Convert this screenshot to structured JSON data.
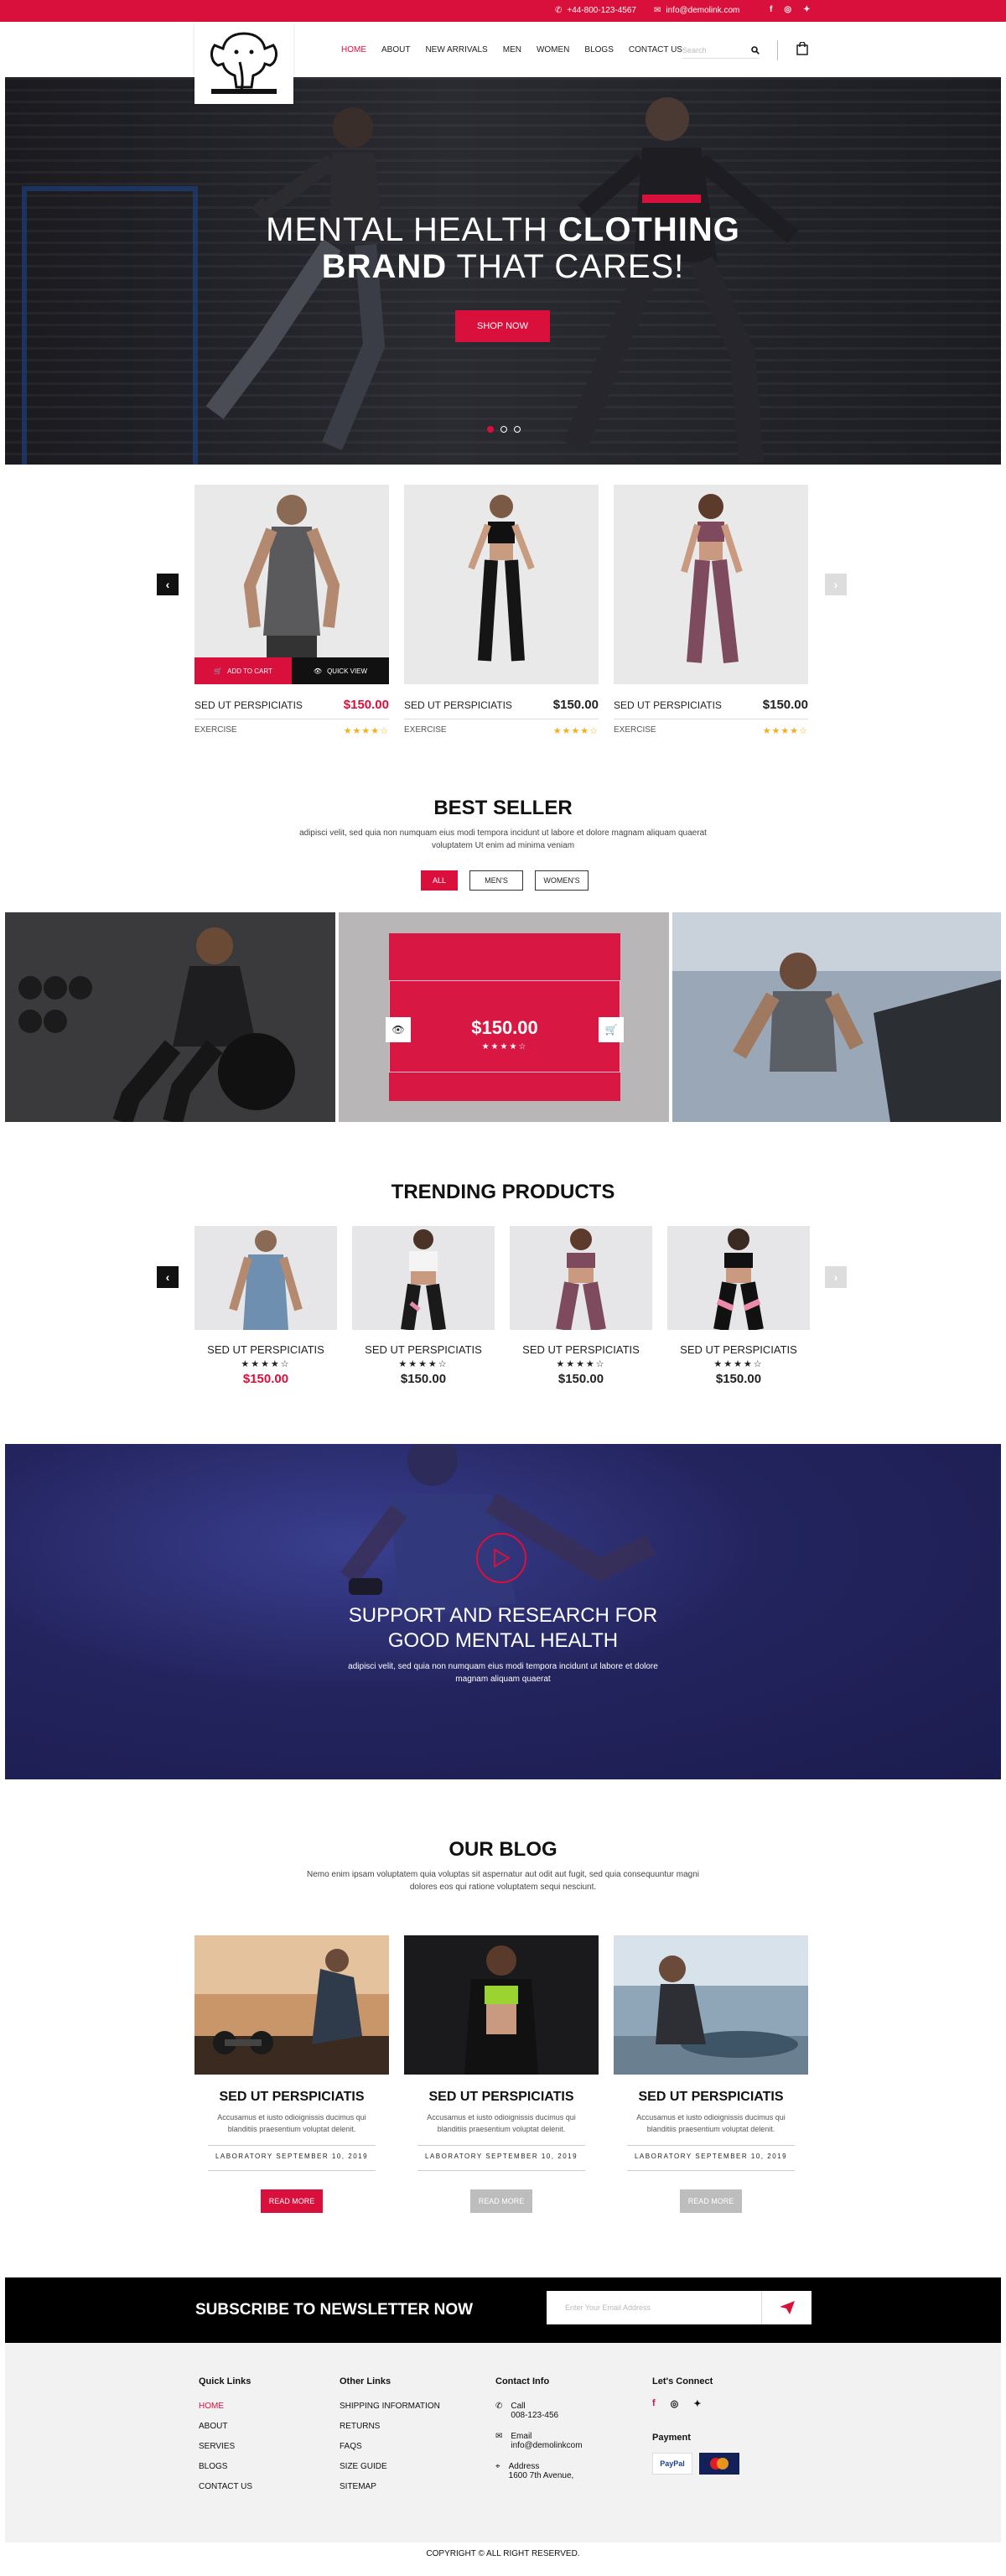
{
  "colors": {
    "accent": "#d90f3c",
    "dark": "#111111",
    "banner": "#1f2057"
  },
  "topbar": {
    "phone": "+44-800-123-4567",
    "email": "info@demolink.com"
  },
  "nav": {
    "items": [
      "HOME",
      "ABOUT",
      "NEW ARRIVALS",
      "MEN",
      "WOMEN",
      "BLOGS",
      "CONTACT US"
    ],
    "active": "HOME"
  },
  "search": {
    "placeholder": "Search"
  },
  "hero": {
    "title_1": "MENTAL HEALTH",
    "title_bold_1": "CLOTHING",
    "title_bold_2": "BRAND",
    "title_2": "THAT CARES!",
    "cta": "SHOP NOW"
  },
  "products": {
    "add_to_cart": "ADD TO CART",
    "quick_view": "QUICK VIEW",
    "items": [
      {
        "name": "SED UT PERSPICIATIS",
        "price": "$150.00",
        "category": "EXERCISE",
        "price_color": "#d90f3c"
      },
      {
        "name": "SED UT PERSPICIATIS",
        "price": "$150.00",
        "category": "EXERCISE",
        "price_color": "#111111"
      },
      {
        "name": "SED UT PERSPICIATIS",
        "price": "$150.00",
        "category": "EXERCISE",
        "price_color": "#111111"
      }
    ],
    "rating": "★★★★☆"
  },
  "best_seller": {
    "title": "BEST SELLER",
    "subtitle": "adipisci velit, sed quia non numquam eius modi tempora incidunt ut labore et dolore magnam aliquam quaerat voluptatem Ut enim ad minima veniam",
    "filters": [
      "ALL",
      "MEN'S",
      "WOMEN'S"
    ],
    "overlay_price": "$150.00",
    "overlay_rating": "★★★★☆"
  },
  "trending": {
    "title": "TRENDING PRODUCTS",
    "items": [
      {
        "name": "SED UT PERSPICIATIS",
        "rating": "★★★★☆",
        "price": "$150.00"
      },
      {
        "name": "SED UT PERSPICIATIS",
        "rating": "★★★★☆",
        "price": "$150.00"
      },
      {
        "name": "SED UT PERSPICIATIS",
        "rating": "★★★★☆",
        "price": "$150.00"
      },
      {
        "name": "SED UT PERSPICIATIS",
        "rating": "★★★★☆",
        "price": "$150.00"
      }
    ]
  },
  "video": {
    "title_1": "SUPPORT AND RESEARCH FOR",
    "title_2": "GOOD MENTAL HEALTH",
    "text": "adipisci velit, sed quia non numquam eius modi tempora incidunt ut labore et dolore magnam aliquam quaerat"
  },
  "blog": {
    "title": "OUR BLOG",
    "subtitle": "Nemo enim ipsam voluptatem quia voluptas sit aspernatur aut odit aut fugit, sed quia consequuntur magni dolores eos qui ratione voluptatem sequi nesciunt.",
    "posts": [
      {
        "title": "SED UT PERSPICIATIS",
        "excerpt": "Accusamus et iusto odioignissis ducimus qui blanditiis praesentium voluptat delenit.",
        "date": "LABORATORY SEPTEMBER 10, 2019",
        "cta": "READ MORE"
      },
      {
        "title": "SED UT PERSPICIATIS",
        "excerpt": "Accusamus et iusto odioignissis ducimus qui blanditiis praesentium voluptat delenit.",
        "date": "LABORATORY SEPTEMBER 10, 2019",
        "cta": "READ MORE"
      },
      {
        "title": "SED UT PERSPICIATIS",
        "excerpt": "Accusamus et iusto odioignissis ducimus qui blanditiis praesentium voluptat delenit.",
        "date": "LABORATORY SEPTEMBER 10, 2019",
        "cta": "READ MORE"
      }
    ]
  },
  "newsletter": {
    "title": "SUBSCRIBE TO NEWSLETTER NOW",
    "placeholder": "Enter Your Email Address"
  },
  "footer": {
    "quick_links": {
      "title": "Quick Links",
      "items": [
        "HOME",
        "ABOUT",
        "SERVIES",
        "BLOGS",
        "CONTACT US"
      ]
    },
    "other_links": {
      "title": "Other Links",
      "items": [
        "SHIPPING INFORMATION",
        "RETURNS",
        "FAQS",
        "SIZE GUIDE",
        "SITEMAP"
      ]
    },
    "contact": {
      "title": "Contact Info",
      "call_label": "Call",
      "call": "008-123-456",
      "email_label": "Email",
      "email": "info@demolinkcom",
      "address_label": "Address",
      "address": "1600 7th Avenue,"
    },
    "connect": {
      "title": "Let's Connect"
    },
    "payment": {
      "title": "Payment",
      "paypal": "PayPal",
      "mastercard": "MasterCard"
    },
    "copyright": "COPYRIGHT © ALL RIGHT RESERVED."
  }
}
